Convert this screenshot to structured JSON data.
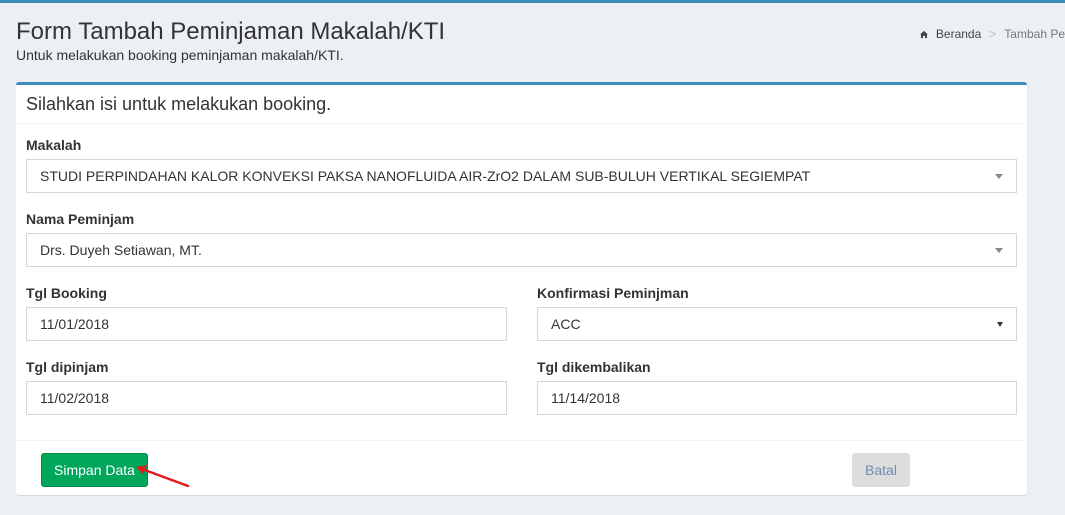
{
  "header": {
    "title": "Form Tambah Peminjaman Makalah/KTI",
    "subtitle": "Untuk melakukan booking peminjaman makalah/KTI."
  },
  "breadcrumb": {
    "home_label": "Beranda",
    "separator": ">",
    "current": "Tambah Pe"
  },
  "box": {
    "title": "Silahkan isi untuk melakukan booking."
  },
  "form": {
    "makalah": {
      "label": "Makalah",
      "value": "STUDI PERPINDAHAN KALOR KONVEKSI PAKSA NANOFLUIDA AIR-ZrO2 DALAM SUB-BULUH VERTIKAL SEGIEMPAT"
    },
    "nama_peminjam": {
      "label": "Nama Peminjam",
      "value": "Drs. Duyeh Setiawan, MT."
    },
    "tgl_booking": {
      "label": "Tgl Booking",
      "value": "11/01/2018"
    },
    "konfirmasi": {
      "label": "Konfirmasi Peminjman",
      "value": "ACC"
    },
    "tgl_dipinjam": {
      "label": "Tgl dipinjam",
      "value": "11/02/2018"
    },
    "tgl_dikembalikan": {
      "label": "Tgl dikembalikan",
      "value": "11/14/2018"
    }
  },
  "footer": {
    "save_label": "Simpan Data",
    "cancel_label": "Batal"
  },
  "colors": {
    "accent": "#3c8dbc",
    "save": "#00a65a",
    "arrow": "#e01b1b"
  }
}
